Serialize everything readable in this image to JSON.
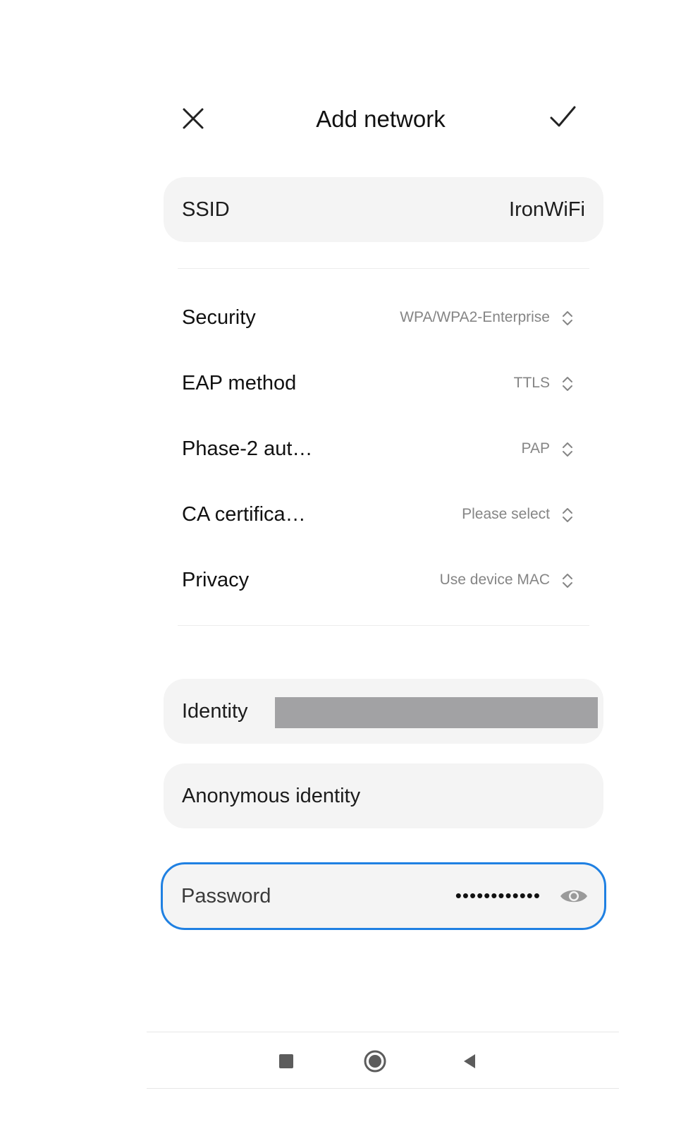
{
  "header": {
    "title": "Add network",
    "close_icon": "close-icon",
    "confirm_icon": "check-icon"
  },
  "ssid": {
    "label": "SSID",
    "value": "IronWiFi"
  },
  "settings": [
    {
      "label": "Security",
      "value": "WPA/WPA2-Enterprise"
    },
    {
      "label": "EAP method",
      "value": "TTLS"
    },
    {
      "label": "Phase-2 aut…",
      "value": "PAP"
    },
    {
      "label": "CA certifica…",
      "value": "Please select"
    },
    {
      "label": "Privacy",
      "value": "Use device MAC"
    }
  ],
  "identity": {
    "label": "Identity"
  },
  "anonymous_identity": {
    "label": "Anonymous identity"
  },
  "password": {
    "label": "Password",
    "masked_value": "••••••••••••",
    "visibility_icon": "eye-icon"
  },
  "nav": {
    "recents_icon": "square-icon",
    "home_icon": "circle-icon",
    "back_icon": "triangle-back-icon"
  },
  "colors": {
    "accent": "#1f80e2",
    "field_bg": "#f4f4f4",
    "secondary_text": "#858585",
    "redaction": "#a2a2a4"
  }
}
